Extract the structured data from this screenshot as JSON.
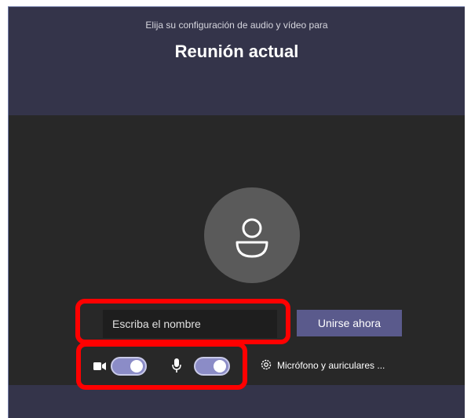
{
  "header": {
    "subtitle": "Elija su configuración de audio y vídeo para",
    "title": "Reunión actual"
  },
  "join": {
    "name_placeholder": "Escriba el nombre",
    "join_label": "Unirse ahora"
  },
  "controls": {
    "camera_on": true,
    "mic_on": true,
    "device_settings_label": "Micrófono y auriculares ..."
  },
  "icons": [
    "person-icon",
    "camera-icon",
    "microphone-icon",
    "gear-icon"
  ],
  "colors": {
    "background": "#34344a",
    "stage": "#282828",
    "accent": "#5a5a8c",
    "toggle": "#8b8cc7",
    "highlight": "#ff0000"
  }
}
